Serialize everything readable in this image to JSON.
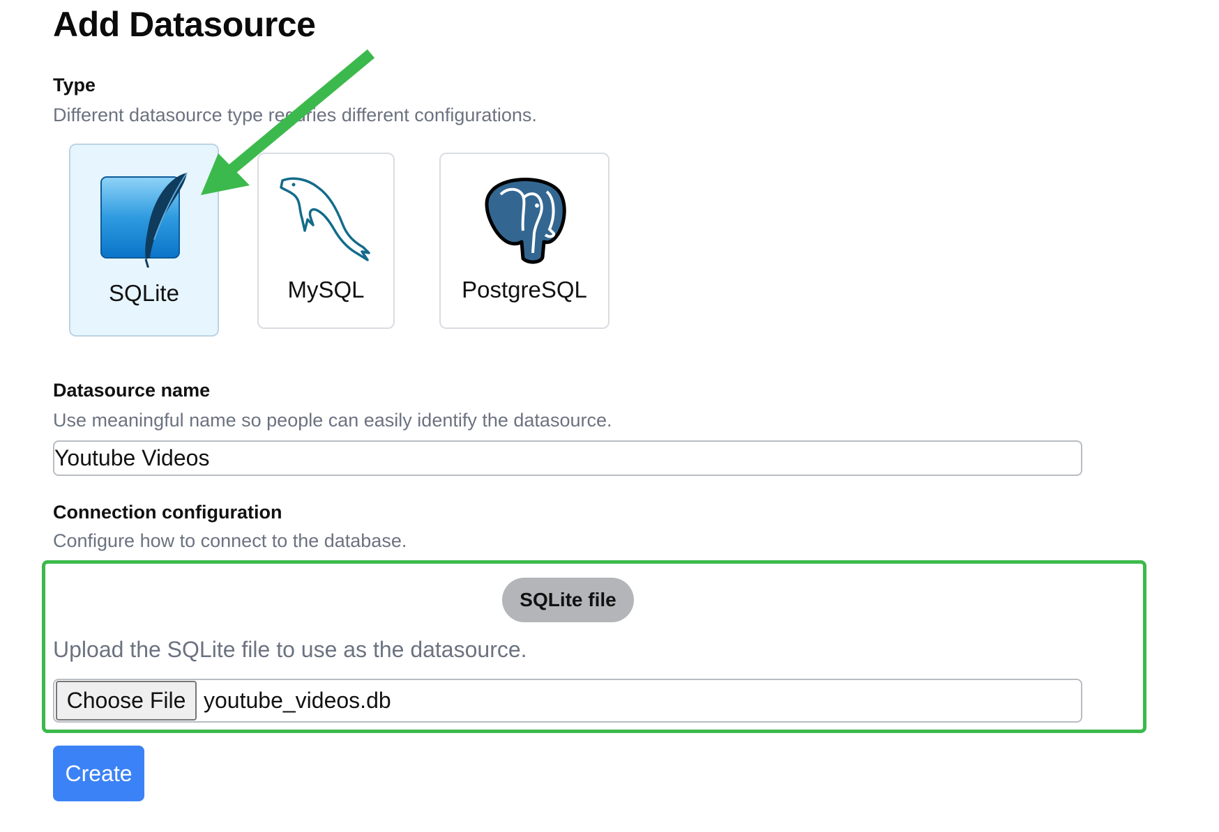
{
  "page_title": "Add Datasource",
  "type_section": {
    "label": "Type",
    "description": "Different datasource type requries different configurations.",
    "options": [
      {
        "label": "SQLite",
        "icon": "sqlite-feather-icon",
        "selected": true
      },
      {
        "label": "MySQL",
        "icon": "mysql-dolphin-icon",
        "selected": false
      },
      {
        "label": "PostgreSQL",
        "icon": "postgresql-elephant-icon",
        "selected": false
      }
    ]
  },
  "name_section": {
    "label": "Datasource name",
    "description": "Use meaningful name so people can easily identify the datasource.",
    "value": "Youtube Videos"
  },
  "connection_section": {
    "label": "Connection configuration",
    "description": "Configure how to connect to the database.",
    "mode_pill": "SQLite file",
    "upload_description": "Upload the SQLite file to use as the datasource.",
    "choose_file_label": "Choose File",
    "file_name": "youtube_videos.db"
  },
  "create_label": "Create",
  "colors": {
    "annotation_green": "#3cb94c",
    "selected_card_bg": "#e6f5fe",
    "primary_button": "#3b82f6",
    "muted_text": "#6b7280"
  }
}
